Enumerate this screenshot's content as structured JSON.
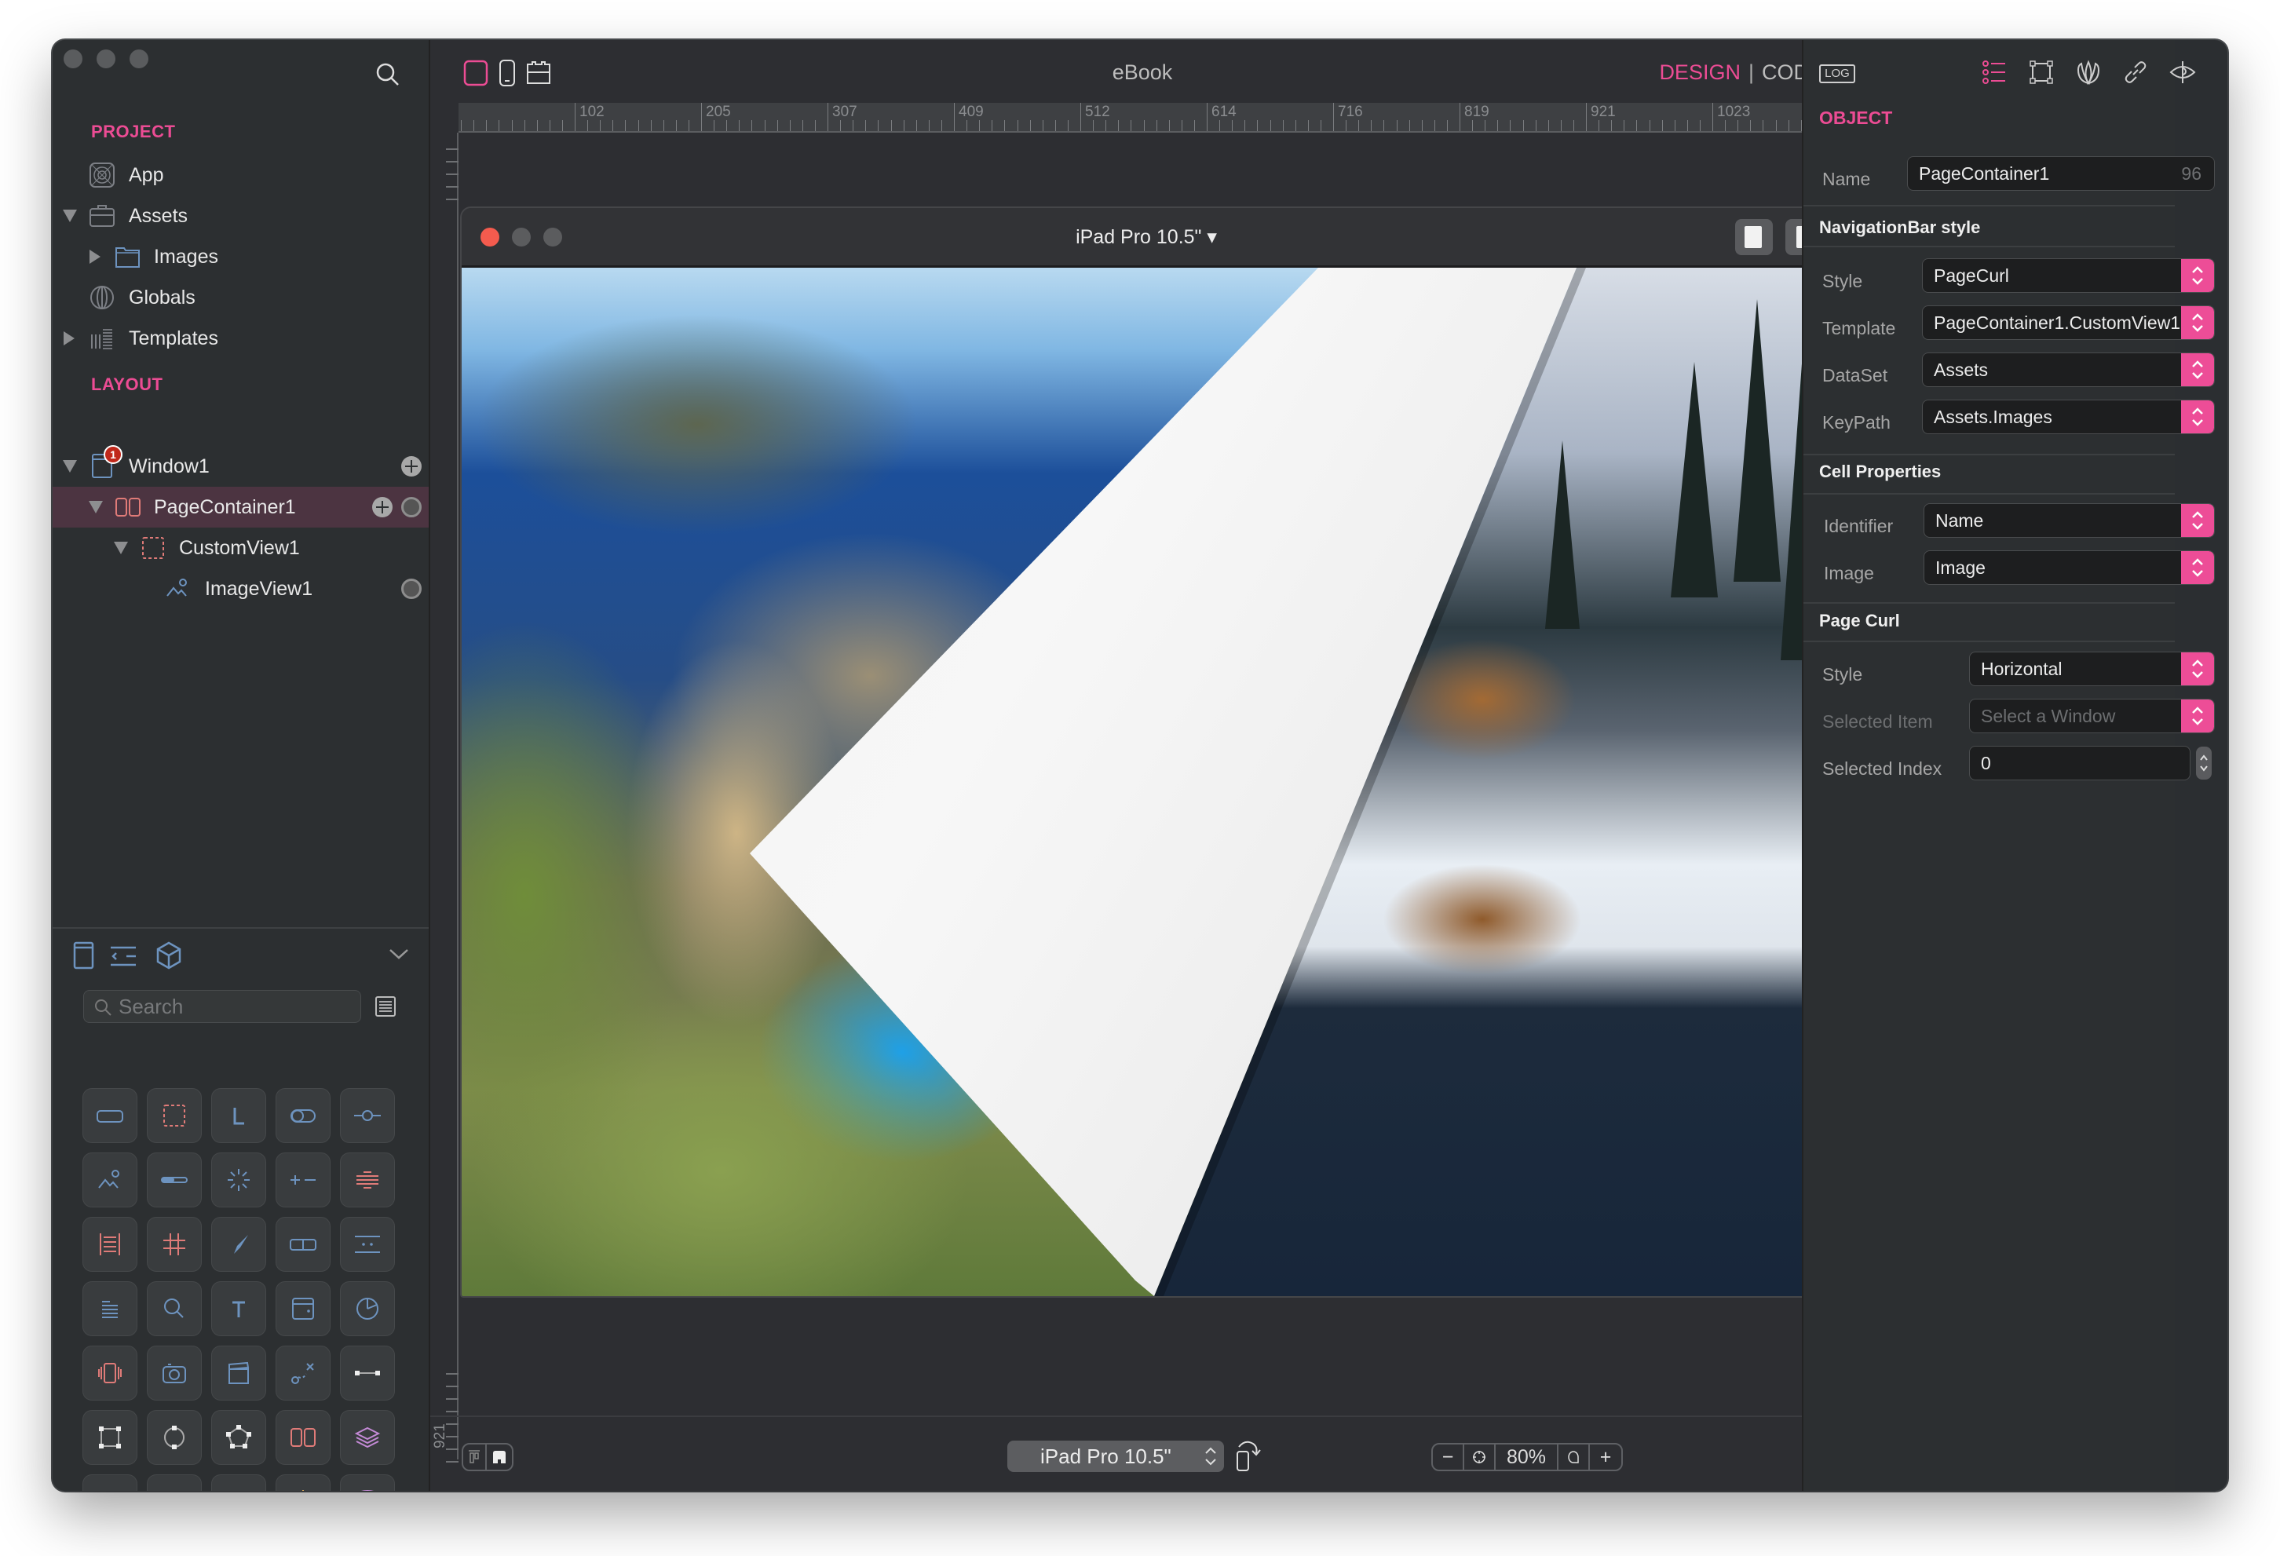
{
  "window": {
    "title": "eBook"
  },
  "sidebar": {
    "project_title": "PROJECT",
    "project_items": [
      {
        "label": "App",
        "icon": "app-icon",
        "disclosure": "none"
      },
      {
        "label": "Assets",
        "icon": "briefcase-icon",
        "disclosure": "expanded"
      },
      {
        "label": "Images",
        "icon": "folder-icon",
        "disclosure": "collapsed"
      },
      {
        "label": "Globals",
        "icon": "globe-icon",
        "disclosure": "none"
      },
      {
        "label": "Templates",
        "icon": "templates-icon",
        "disclosure": "collapsed"
      }
    ],
    "layout_title": "LAYOUT",
    "layout_items": [
      {
        "label": "Window1",
        "icon": "window-icon",
        "badge": "1",
        "disclosure": "expanded"
      },
      {
        "label": "PageContainer1",
        "icon": "page-container-icon",
        "selected": true,
        "disclosure": "expanded"
      },
      {
        "label": "CustomView1",
        "icon": "custom-view-icon",
        "disclosure": "expanded"
      },
      {
        "label": "ImageView1",
        "icon": "image-view-icon",
        "disclosure": "none"
      }
    ]
  },
  "library": {
    "search_placeholder": "Search",
    "tabs": [
      "controls-icon",
      "code-snippets-icon",
      "objects-cube-icon"
    ],
    "items": [
      "button-icon",
      "view-icon",
      "label-icon",
      "switch-icon",
      "slider-icon",
      "image-view-icon",
      "progress-icon",
      "spinner-icon",
      "stepper-icon",
      "separator-icon",
      "list-icon",
      "grid-icon",
      "compass-icon",
      "segmented-icon",
      "pager-icon",
      "text-icon",
      "search-icon",
      "textfield-icon",
      "datepicker-icon",
      "piechart-icon",
      "carousel-icon",
      "camera-icon",
      "video-icon",
      "path-icon",
      "line-shape-icon",
      "rectangle-shape-icon",
      "circle-shape-icon",
      "polygon-shape-icon",
      "page-container-icon",
      "layers-icon",
      "layers-icon-2",
      "layers-icon-3",
      "map-pin-icon",
      "gyroscope-icon",
      "database-icon"
    ]
  },
  "toolbar": {
    "doc_title": "eBook",
    "mode_design": "DESIGN",
    "mode_separator": "|",
    "mode_code": "CODE",
    "ruler_labels": [
      "102",
      "205",
      "307",
      "409",
      "512",
      "614",
      "716",
      "819",
      "921",
      "1023"
    ],
    "vruler_label": "921"
  },
  "canvas": {
    "device_name": "iPad Pro 10.5\" ▾",
    "curl_style": "PageCurl"
  },
  "bottom": {
    "device_select": "iPad Pro 10.5\"",
    "zoom_minus": "−",
    "zoom_level": "80%",
    "zoom_plus": "+"
  },
  "inspector": {
    "log_label": "LOG",
    "section": "OBJECT",
    "name_label": "Name",
    "name_value": "PageContainer1",
    "name_count": "96",
    "navbar_group": "NavigationBar style",
    "style_label": "Style",
    "style_value": "PageCurl",
    "template_label": "Template",
    "template_value": "PageContainer1.CustomView1",
    "dataset_label": "DataSet",
    "dataset_value": "Assets",
    "keypath_label": "KeyPath",
    "keypath_value": "Assets.Images",
    "cell_group": "Cell Properties",
    "identifier_label": "Identifier",
    "identifier_value": "Name",
    "image_label": "Image",
    "image_value": "Image",
    "curl_group": "Page Curl",
    "curl_style_label": "Style",
    "curl_style_value": "Horizontal",
    "selected_item_label": "Selected Item",
    "selected_item_placeholder": "Select a Window",
    "selected_index_label": "Selected Index",
    "selected_index_value": "0"
  },
  "colors": {
    "accent": "#ec4c94",
    "background": "#2b2e31",
    "selection": "#4c3441",
    "close": "#f45b4e"
  }
}
